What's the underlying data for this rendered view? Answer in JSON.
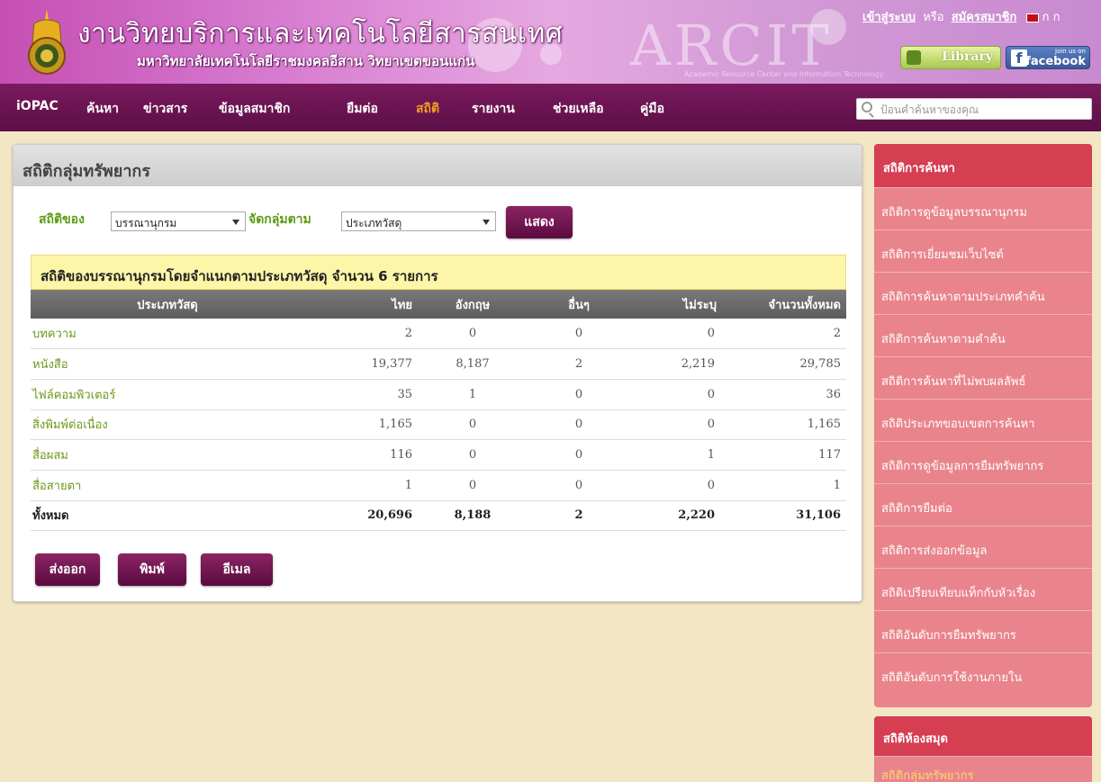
{
  "header": {
    "title": "งานวิทยบริการและเทคโนโลยีสารสนเทศ",
    "subtitle": "มหาวิทยาลัยเทคโนโลยีราชมงคลอีสาน วิทยาเขตขอนแก่น",
    "brand": "ARCIT",
    "brand_sub": "Academic Resource Center and Information Technology",
    "login": "เข้าสู่ระบบ",
    "or": "หรือ",
    "register": "สมัครสมาชิก",
    "lang": "ก ก",
    "library_btn": "Library",
    "facebook_join": "Join us on",
    "facebook_label": "facebook"
  },
  "nav": {
    "items": [
      "iOPAC",
      "ค้นหา",
      "ข่าวสาร",
      "ข้อมูลสมาชิก",
      "ยืมต่อ",
      "สถิติ",
      "รายงาน",
      "ช่วยเหลือ",
      "คู่มือ"
    ],
    "active": "สถิติ",
    "search_placeholder": "ป้อนคำค้นหาของคุณ"
  },
  "main": {
    "title": "สถิติกลุ่มทรัพยากร",
    "filter_of_label": "สถิติของ",
    "filter_of_value": "บรรณานุกรม",
    "group_by_label": "จัดกลุ่มตาม",
    "group_by_value": "ประเภทวัสดุ",
    "show_btn": "แสดง",
    "table_title": "สถิติของบรรณานุกรมโดยจำแนกตามประเภทวัสดุ จำนวน 6 รายการ",
    "columns": [
      "ประเภทวัสดุ",
      "ไทย",
      "อังกฤษ",
      "อื่นๆ",
      "ไม่ระบุ",
      "จำนวนทั้งหมด"
    ],
    "rows": [
      {
        "name": "บทความ",
        "thai": "2",
        "english": "0",
        "other": "0",
        "unspecified": "0",
        "total": "2"
      },
      {
        "name": "หนังสือ",
        "thai": "19,377",
        "english": "8,187",
        "other": "2",
        "unspecified": "2,219",
        "total": "29,785"
      },
      {
        "name": "ไฟล์คอมพิวเตอร์",
        "thai": "35",
        "english": "1",
        "other": "0",
        "unspecified": "0",
        "total": "36"
      },
      {
        "name": "สิ่งพิมพ์ต่อเนื่อง",
        "thai": "1,165",
        "english": "0",
        "other": "0",
        "unspecified": "0",
        "total": "1,165"
      },
      {
        "name": "สื่อผสม",
        "thai": "116",
        "english": "0",
        "other": "0",
        "unspecified": "1",
        "total": "117"
      },
      {
        "name": "สื่อสายตา",
        "thai": "1",
        "english": "0",
        "other": "0",
        "unspecified": "0",
        "total": "1"
      }
    ],
    "total_row": {
      "name": "ทั้งหมด",
      "thai": "20,696",
      "english": "8,188",
      "other": "2",
      "unspecified": "2,220",
      "total": "31,106"
    },
    "export_btn": "ส่งออก",
    "print_btn": "พิมพ์",
    "email_btn": "อีเมล"
  },
  "sidebar": {
    "search_stats_title": "สถิติการค้นหา",
    "search_stats_items": [
      "สถิติการดูข้อมูลบรรณานุกรม",
      "สถิติการเยี่ยมชมเว็บไซต์",
      "สถิติการค้นหาตามประเภทคำค้น",
      "สถิติการค้นหาตามคำค้น",
      "สถิติการค้นหาที่ไม่พบผลลัพธ์",
      "สถิติประเภทขอบเขตการค้นหา",
      "สถิติการดูข้อมูลการยืมทรัพยากร",
      "สถิติการยืมต่อ",
      "สถิติการส่งออกข้อมูล",
      "สถิติเปรียบเทียบแท็กกับหัวเรื่อง",
      "สถิติอันดับการยืมทรัพยากร",
      "สถิติอันดับการใช้งานภายใน"
    ],
    "library_stats_title": "สถิติห้องสมุด",
    "library_stats_items": [
      "สถิติกลุ่มทรัพยากร"
    ]
  },
  "colors": {
    "nav_bg": "#6a1451",
    "accent_active": "#f0a020",
    "sidebar_head": "#d63e52",
    "sidebar_bg": "#e9848c",
    "label_green": "#5b9b12"
  }
}
